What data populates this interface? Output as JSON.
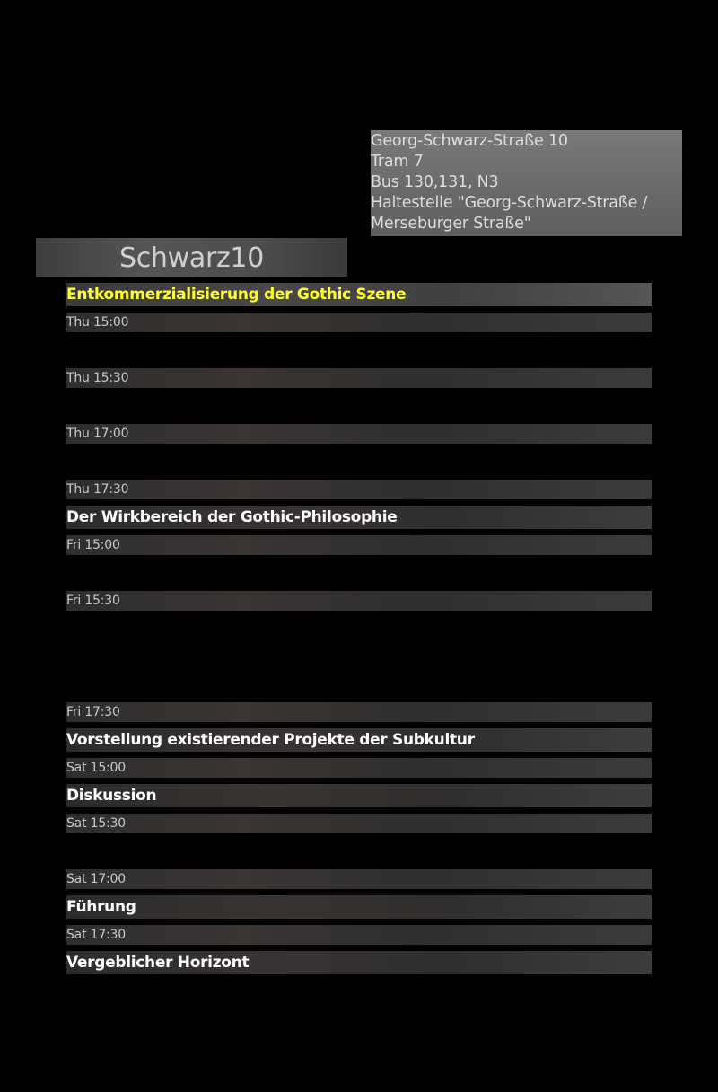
{
  "venue": {
    "name": "Schwarz10",
    "address_lines": [
      "Georg-Schwarz-Straße 10",
      "Tram 7",
      "Bus 130,131, N3",
      "Haltestelle \"Georg-Schwarz-Straße /",
      "Merseburger Straße\""
    ]
  },
  "schedule": [
    {
      "kind": "event",
      "label": "Entkommerzialisierung der Gothic Szene",
      "highlighted": true
    },
    {
      "kind": "time",
      "label": "Thu 15:00"
    },
    {
      "kind": "time",
      "label": "Thu 15:30"
    },
    {
      "kind": "time",
      "label": "Thu 17:00"
    },
    {
      "kind": "time",
      "label": "Thu 17:30"
    },
    {
      "kind": "event",
      "label": "Der Wirkbereich der Gothic-Philosophie"
    },
    {
      "kind": "time",
      "label": "Fri 15:00"
    },
    {
      "kind": "time",
      "label": "Fri 15:30"
    },
    {
      "kind": "time",
      "label": "Fri 17:30"
    },
    {
      "kind": "event",
      "label": "Vorstellung existierender Projekte der Subkultur"
    },
    {
      "kind": "time",
      "label": "Sat 15:00"
    },
    {
      "kind": "event",
      "label": "Diskussion"
    },
    {
      "kind": "time",
      "label": "Sat 15:30"
    },
    {
      "kind": "time",
      "label": "Sat 17:00"
    },
    {
      "kind": "event",
      "label": "Führung"
    },
    {
      "kind": "time",
      "label": "Sat 17:30"
    },
    {
      "kind": "event",
      "label": "Vergeblicher Horizont"
    }
  ],
  "colors": {
    "background": "#000000",
    "highlight_text": "#ffff33",
    "event_text": "#ffffff",
    "time_text": "#c8c8c8"
  }
}
